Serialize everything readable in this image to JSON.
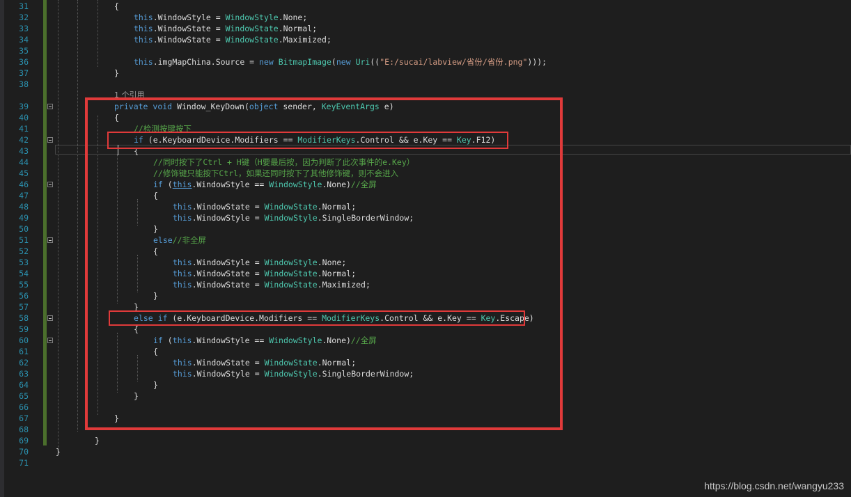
{
  "editor": {
    "lines": [
      {
        "num": "31",
        "indent": 3,
        "tokens": [
          {
            "t": "{",
            "c": "p"
          }
        ]
      },
      {
        "num": "32",
        "indent": 4,
        "tokens": [
          {
            "t": "this",
            "c": "k"
          },
          {
            "t": ".WindowStyle = ",
            "c": "p"
          },
          {
            "t": "WindowStyle",
            "c": "t"
          },
          {
            "t": ".None;",
            "c": "p"
          }
        ]
      },
      {
        "num": "33",
        "indent": 4,
        "tokens": [
          {
            "t": "this",
            "c": "k"
          },
          {
            "t": ".WindowState = ",
            "c": "p"
          },
          {
            "t": "WindowState",
            "c": "t"
          },
          {
            "t": ".Normal;",
            "c": "p"
          }
        ]
      },
      {
        "num": "34",
        "indent": 4,
        "tokens": [
          {
            "t": "this",
            "c": "k"
          },
          {
            "t": ".WindowState = ",
            "c": "p"
          },
          {
            "t": "WindowState",
            "c": "t"
          },
          {
            "t": ".Maximized;",
            "c": "p"
          }
        ]
      },
      {
        "num": "35",
        "indent": 0,
        "tokens": []
      },
      {
        "num": "36",
        "indent": 4,
        "tokens": [
          {
            "t": "this",
            "c": "k"
          },
          {
            "t": ".imgMapChina.Source = ",
            "c": "p"
          },
          {
            "t": "new",
            "c": "k"
          },
          {
            "t": " ",
            "c": "p"
          },
          {
            "t": "BitmapImage",
            "c": "t"
          },
          {
            "t": "(",
            "c": "p"
          },
          {
            "t": "new",
            "c": "k"
          },
          {
            "t": " ",
            "c": "p"
          },
          {
            "t": "Uri",
            "c": "t"
          },
          {
            "t": "((",
            "c": "p"
          },
          {
            "t": "\"E:/sucai/labview/省份/省份.png\"",
            "c": "s"
          },
          {
            "t": ")));",
            "c": "p"
          }
        ]
      },
      {
        "num": "37",
        "indent": 3,
        "tokens": [
          {
            "t": "}",
            "c": "p"
          }
        ]
      },
      {
        "num": "38",
        "indent": 0,
        "tokens": []
      },
      {
        "num": "",
        "indent": 3,
        "ref": true,
        "tokens": [
          {
            "t": "1 个引用",
            "c": "p"
          }
        ]
      },
      {
        "num": "39",
        "indent": 3,
        "fold": true,
        "tokens": [
          {
            "t": "private",
            "c": "k"
          },
          {
            "t": " ",
            "c": "p"
          },
          {
            "t": "void",
            "c": "k"
          },
          {
            "t": " Window_KeyDown(",
            "c": "p"
          },
          {
            "t": "object",
            "c": "k"
          },
          {
            "t": " sender, ",
            "c": "p"
          },
          {
            "t": "KeyEventArgs",
            "c": "t"
          },
          {
            "t": " e)",
            "c": "p"
          }
        ]
      },
      {
        "num": "40",
        "indent": 3,
        "tokens": [
          {
            "t": "{",
            "c": "p"
          }
        ]
      },
      {
        "num": "41",
        "indent": 4,
        "tokens": [
          {
            "t": "//检测按键按下",
            "c": "c"
          }
        ]
      },
      {
        "num": "42",
        "indent": 4,
        "fold": true,
        "tokens": [
          {
            "t": "if",
            "c": "k"
          },
          {
            "t": " (e.KeyboardDevice.Modifiers == ",
            "c": "p"
          },
          {
            "t": "ModifierKeys",
            "c": "t"
          },
          {
            "t": ".Control && e.Key == ",
            "c": "p"
          },
          {
            "t": "Key",
            "c": "t"
          },
          {
            "t": ".F12)",
            "c": "p"
          }
        ]
      },
      {
        "num": "43",
        "indent": 4,
        "tokens": [
          {
            "t": "{",
            "c": "p"
          }
        ]
      },
      {
        "num": "44",
        "indent": 5,
        "tokens": [
          {
            "t": "//同时按下了Ctrl + H键（H要最后按，因为判断了此次事件的e.Key）",
            "c": "c"
          }
        ]
      },
      {
        "num": "45",
        "indent": 5,
        "tokens": [
          {
            "t": "//修饰键只能按下Ctrl，如果还同时按下了其他修饰键，则不会进入",
            "c": "c"
          }
        ]
      },
      {
        "num": "46",
        "indent": 5,
        "fold": true,
        "tokens": [
          {
            "t": "if",
            "c": "k"
          },
          {
            "t": " (",
            "c": "p"
          },
          {
            "t": "this",
            "c": "u"
          },
          {
            "t": ".WindowStyle == ",
            "c": "p"
          },
          {
            "t": "WindowStyle",
            "c": "t"
          },
          {
            "t": ".None)",
            "c": "p"
          },
          {
            "t": "//全屏",
            "c": "c"
          }
        ]
      },
      {
        "num": "47",
        "indent": 5,
        "tokens": [
          {
            "t": "{",
            "c": "p"
          }
        ]
      },
      {
        "num": "48",
        "indent": 6,
        "tokens": [
          {
            "t": "this",
            "c": "k"
          },
          {
            "t": ".WindowState = ",
            "c": "p"
          },
          {
            "t": "WindowState",
            "c": "t"
          },
          {
            "t": ".Normal;",
            "c": "p"
          }
        ]
      },
      {
        "num": "49",
        "indent": 6,
        "tokens": [
          {
            "t": "this",
            "c": "k"
          },
          {
            "t": ".WindowStyle = ",
            "c": "p"
          },
          {
            "t": "WindowStyle",
            "c": "t"
          },
          {
            "t": ".SingleBorderWindow;",
            "c": "p"
          }
        ]
      },
      {
        "num": "50",
        "indent": 5,
        "tokens": [
          {
            "t": "}",
            "c": "p"
          }
        ]
      },
      {
        "num": "51",
        "indent": 5,
        "fold": true,
        "tokens": [
          {
            "t": "else",
            "c": "k"
          },
          {
            "t": "//非全屏",
            "c": "c"
          }
        ]
      },
      {
        "num": "52",
        "indent": 5,
        "tokens": [
          {
            "t": "{",
            "c": "p"
          }
        ]
      },
      {
        "num": "53",
        "indent": 6,
        "tokens": [
          {
            "t": "this",
            "c": "k"
          },
          {
            "t": ".WindowStyle = ",
            "c": "p"
          },
          {
            "t": "WindowStyle",
            "c": "t"
          },
          {
            "t": ".None;",
            "c": "p"
          }
        ]
      },
      {
        "num": "54",
        "indent": 6,
        "tokens": [
          {
            "t": "this",
            "c": "k"
          },
          {
            "t": ".WindowState = ",
            "c": "p"
          },
          {
            "t": "WindowState",
            "c": "t"
          },
          {
            "t": ".Normal;",
            "c": "p"
          }
        ]
      },
      {
        "num": "55",
        "indent": 6,
        "tokens": [
          {
            "t": "this",
            "c": "k"
          },
          {
            "t": ".WindowState = ",
            "c": "p"
          },
          {
            "t": "WindowState",
            "c": "t"
          },
          {
            "t": ".Maximized;",
            "c": "p"
          }
        ]
      },
      {
        "num": "56",
        "indent": 5,
        "tokens": [
          {
            "t": "}",
            "c": "p"
          }
        ]
      },
      {
        "num": "57",
        "indent": 4,
        "tokens": [
          {
            "t": "}",
            "c": "p"
          }
        ]
      },
      {
        "num": "58",
        "indent": 4,
        "fold": true,
        "tokens": [
          {
            "t": "else",
            "c": "k"
          },
          {
            "t": " ",
            "c": "p"
          },
          {
            "t": "if",
            "c": "k"
          },
          {
            "t": " (e.KeyboardDevice.Modifiers == ",
            "c": "p"
          },
          {
            "t": "ModifierKeys",
            "c": "t"
          },
          {
            "t": ".Control && e.Key == ",
            "c": "p"
          },
          {
            "t": "Key",
            "c": "t"
          },
          {
            "t": ".Escape)",
            "c": "p"
          }
        ]
      },
      {
        "num": "59",
        "indent": 4,
        "tokens": [
          {
            "t": "{",
            "c": "p"
          }
        ]
      },
      {
        "num": "60",
        "indent": 5,
        "fold": true,
        "tokens": [
          {
            "t": "if",
            "c": "k"
          },
          {
            "t": " (",
            "c": "p"
          },
          {
            "t": "this",
            "c": "k"
          },
          {
            "t": ".WindowStyle == ",
            "c": "p"
          },
          {
            "t": "WindowStyle",
            "c": "t"
          },
          {
            "t": ".None)",
            "c": "p"
          },
          {
            "t": "//全屏",
            "c": "c"
          }
        ]
      },
      {
        "num": "61",
        "indent": 5,
        "tokens": [
          {
            "t": "{",
            "c": "p"
          }
        ]
      },
      {
        "num": "62",
        "indent": 6,
        "tokens": [
          {
            "t": "this",
            "c": "k"
          },
          {
            "t": ".WindowState = ",
            "c": "p"
          },
          {
            "t": "WindowState",
            "c": "t"
          },
          {
            "t": ".Normal;",
            "c": "p"
          }
        ]
      },
      {
        "num": "63",
        "indent": 6,
        "tokens": [
          {
            "t": "this",
            "c": "k"
          },
          {
            "t": ".WindowStyle = ",
            "c": "p"
          },
          {
            "t": "WindowStyle",
            "c": "t"
          },
          {
            "t": ".SingleBorderWindow;",
            "c": "p"
          }
        ]
      },
      {
        "num": "64",
        "indent": 5,
        "tokens": [
          {
            "t": "}",
            "c": "p"
          }
        ]
      },
      {
        "num": "65",
        "indent": 4,
        "tokens": [
          {
            "t": "}",
            "c": "p"
          }
        ]
      },
      {
        "num": "66",
        "indent": 0,
        "tokens": []
      },
      {
        "num": "67",
        "indent": 3,
        "tokens": [
          {
            "t": "}",
            "c": "p"
          }
        ]
      },
      {
        "num": "68",
        "indent": 0,
        "tokens": []
      },
      {
        "num": "69",
        "indent": 2,
        "tokens": [
          {
            "t": "}",
            "c": "p"
          }
        ]
      },
      {
        "num": "70",
        "indent": 0,
        "tokens": [
          {
            "t": "}",
            "c": "p"
          }
        ]
      },
      {
        "num": "71",
        "indent": 0,
        "tokens": []
      }
    ]
  },
  "watermark": "https://blog.csdn.net/wangyu233"
}
